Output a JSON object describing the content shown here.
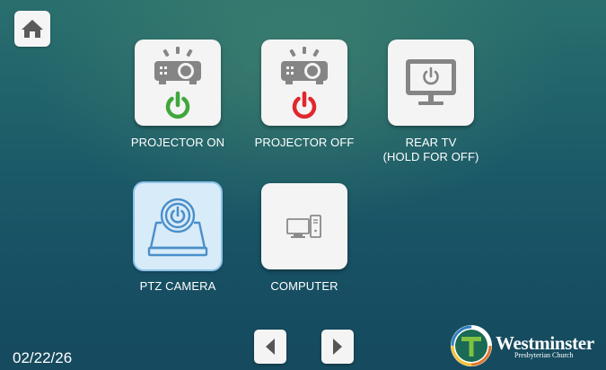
{
  "home": {
    "icon": "home-icon"
  },
  "tiles": [
    {
      "id": "projector-on",
      "label": "PROJECTOR ON",
      "icon": "projector-power-icon",
      "power_color": "#3ea83a"
    },
    {
      "id": "projector-off",
      "label": "PROJECTOR OFF",
      "icon": "projector-power-icon",
      "power_color": "#e0282e"
    },
    {
      "id": "rear-tv",
      "label": "REAR TV",
      "label_line2": "(HOLD FOR OFF)",
      "icon": "tv-power-icon"
    },
    {
      "id": "ptz-camera",
      "label": "PTZ CAMERA",
      "icon": "ptz-camera-icon",
      "selected": true
    },
    {
      "id": "computer",
      "label": "COMPUTER",
      "icon": "computer-icon"
    }
  ],
  "nav": {
    "prev_icon": "triangle-left-icon",
    "next_icon": "triangle-right-icon"
  },
  "date": "02/22/26",
  "logo": {
    "name": "Westminster",
    "subtitle": "Presbyterian Church"
  },
  "colors": {
    "icon_gray": "#8a8a8a",
    "camera_blue": "#4a8fc9"
  }
}
